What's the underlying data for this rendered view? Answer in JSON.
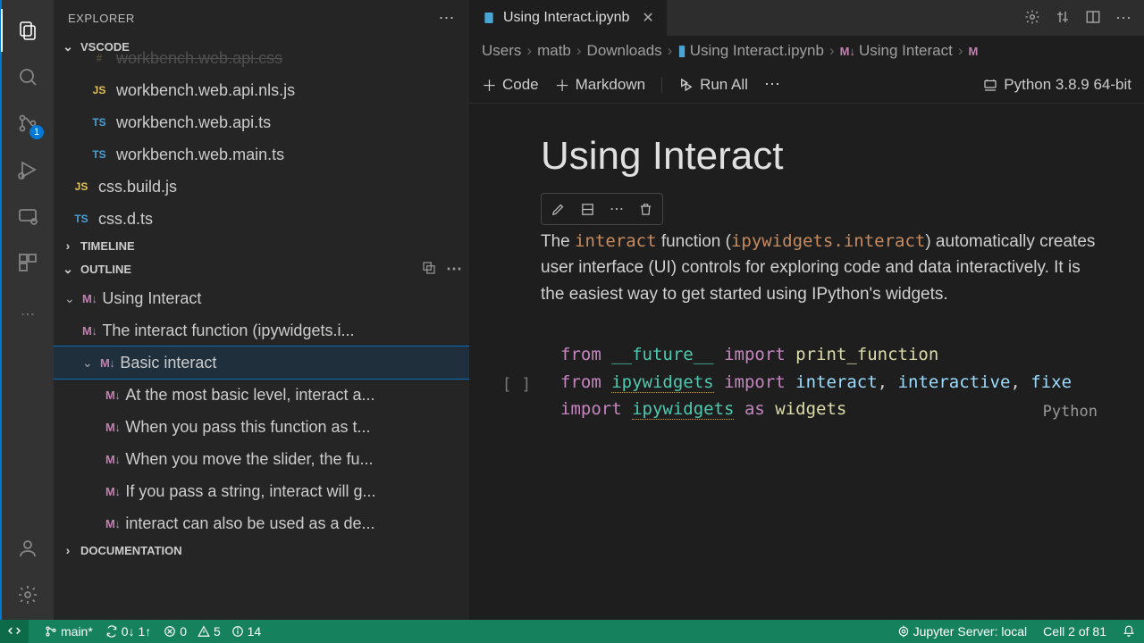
{
  "sidebar": {
    "title": "EXPLORER",
    "sections": {
      "vscode": "VSCODE",
      "timeline": "TIMELINE",
      "outline": "OUTLINE",
      "documentation": "DOCUMENTATION"
    }
  },
  "files": [
    {
      "icon": "JS",
      "cls": "ic-js",
      "name": "workbench.web.api.css"
    },
    {
      "icon": "JS",
      "cls": "ic-js",
      "name": "workbench.web.api.nls.js"
    },
    {
      "icon": "TS",
      "cls": "ic-ts",
      "name": "workbench.web.api.ts"
    },
    {
      "icon": "TS",
      "cls": "ic-ts",
      "name": "workbench.web.main.ts"
    },
    {
      "icon": "JS",
      "cls": "ic-js",
      "name": "css.build.js"
    },
    {
      "icon": "TS",
      "cls": "ic-ts",
      "name": "css.d.ts"
    }
  ],
  "outline": [
    {
      "depth": 0,
      "chev": true,
      "label": "Using Interact"
    },
    {
      "depth": 1,
      "chev": false,
      "label": "The interact function (ipywidgets.i..."
    },
    {
      "depth": 1,
      "chev": true,
      "label": "Basic interact",
      "selected": true
    },
    {
      "depth": 2,
      "chev": false,
      "label": "At the most basic level, interact a..."
    },
    {
      "depth": 2,
      "chev": false,
      "label": "When you pass this function as t..."
    },
    {
      "depth": 2,
      "chev": false,
      "label": "When you move the slider, the fu..."
    },
    {
      "depth": 2,
      "chev": false,
      "label": "If you pass a string, interact will g..."
    },
    {
      "depth": 2,
      "chev": false,
      "label": "interact can also be used as a de..."
    }
  ],
  "tab": {
    "name": "Using Interact.ipynb"
  },
  "breadcrumb": [
    "Users",
    "matb",
    "Downloads",
    "Using Interact.ipynb",
    "Using Interact"
  ],
  "toolbar": {
    "code": "Code",
    "markdown": "Markdown",
    "runall": "Run All",
    "kernel": "Python 3.8.9 64-bit"
  },
  "notebook": {
    "title": "Using Interact",
    "prose_pre": "The ",
    "prose_code1": "interact",
    "prose_mid": " function (",
    "prose_code2": "ipywidgets.interact",
    "prose_post": ") automatically creates user interface (UI) controls for exploring code and data interactively. It is the easiest way to get started using IPython's widgets.",
    "lang": "Python"
  },
  "status": {
    "branch": "main*",
    "sync": "0↓ 1↑",
    "err": "0",
    "warn": "5",
    "info": "14",
    "server": "Jupyter Server: local",
    "cell": "Cell 2 of 81"
  },
  "badge": {
    "scm": "1"
  }
}
